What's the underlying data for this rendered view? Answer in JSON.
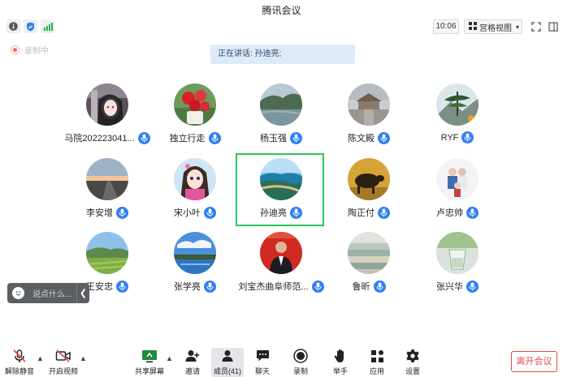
{
  "window": {
    "title": "腾讯会议"
  },
  "toolbar": {
    "time": "10:06",
    "view_label": "宫格视图"
  },
  "recording": {
    "label": "录制中"
  },
  "speaking": {
    "text": "正在讲话: 孙迪亮;"
  },
  "participants": [
    {
      "name": "马院202223041...",
      "avatar": "anime-dark"
    },
    {
      "name": "独立行走",
      "avatar": "roses"
    },
    {
      "name": "杨玉强",
      "avatar": "lake"
    },
    {
      "name": "陈文殿",
      "avatar": "temple"
    },
    {
      "name": "RYF",
      "avatar": "pine"
    },
    {
      "name": "李安增",
      "avatar": "road-sunset"
    },
    {
      "name": "宋小叶",
      "avatar": "anime-girl"
    },
    {
      "name": "孙迪亮",
      "avatar": "coast"
    },
    {
      "name": "陶正付",
      "avatar": "bull"
    },
    {
      "name": "卢忠帅",
      "avatar": "family"
    },
    {
      "name": "王安忠",
      "avatar": "meadow"
    },
    {
      "name": "张学亮",
      "avatar": "sky-lake"
    },
    {
      "name": "刘宝杰曲阜师范...",
      "avatar": "portrait-red"
    },
    {
      "name": "鲁昕",
      "avatar": "books"
    },
    {
      "name": "张兴华",
      "avatar": "glass"
    }
  ],
  "chat": {
    "placeholder": "说点什么..."
  },
  "bottom": {
    "unmute": "解除静音",
    "video": "开启视频",
    "share": "共享屏幕",
    "invite": "邀请",
    "members": "成员(41)",
    "chat": "聊天",
    "record": "录制",
    "hand": "举手",
    "apps": "应用",
    "settings": "设置",
    "leave": "离开会议"
  },
  "colors": {
    "accent": "#2f7ff2",
    "speaker_border": "#2ec45a",
    "leave": "#e04b4b"
  }
}
